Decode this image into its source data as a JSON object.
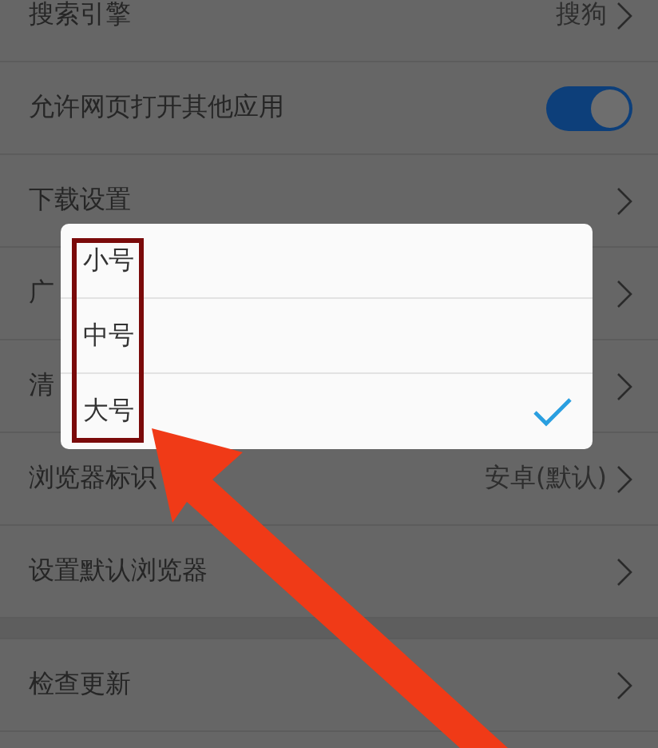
{
  "settings": [
    {
      "kind": "link",
      "label": "搜索引擎",
      "value": "搜狗"
    },
    {
      "kind": "toggle",
      "label": "允许网页打开其他应用",
      "on": true
    },
    {
      "kind": "link",
      "label": "下载设置"
    },
    {
      "kind": "link",
      "label": "广"
    },
    {
      "kind": "link",
      "label": "清"
    },
    {
      "kind": "link",
      "label": "浏览器标识",
      "value": "安卓(默认)"
    },
    {
      "kind": "link",
      "label": "设置默认浏览器"
    },
    {
      "kind": "gap"
    },
    {
      "kind": "link",
      "label": "检查更新"
    }
  ],
  "font_size_dialog": {
    "options": [
      {
        "label": "小号",
        "selected": false
      },
      {
        "label": "中号",
        "selected": false
      },
      {
        "label": "大号",
        "selected": true
      }
    ]
  }
}
